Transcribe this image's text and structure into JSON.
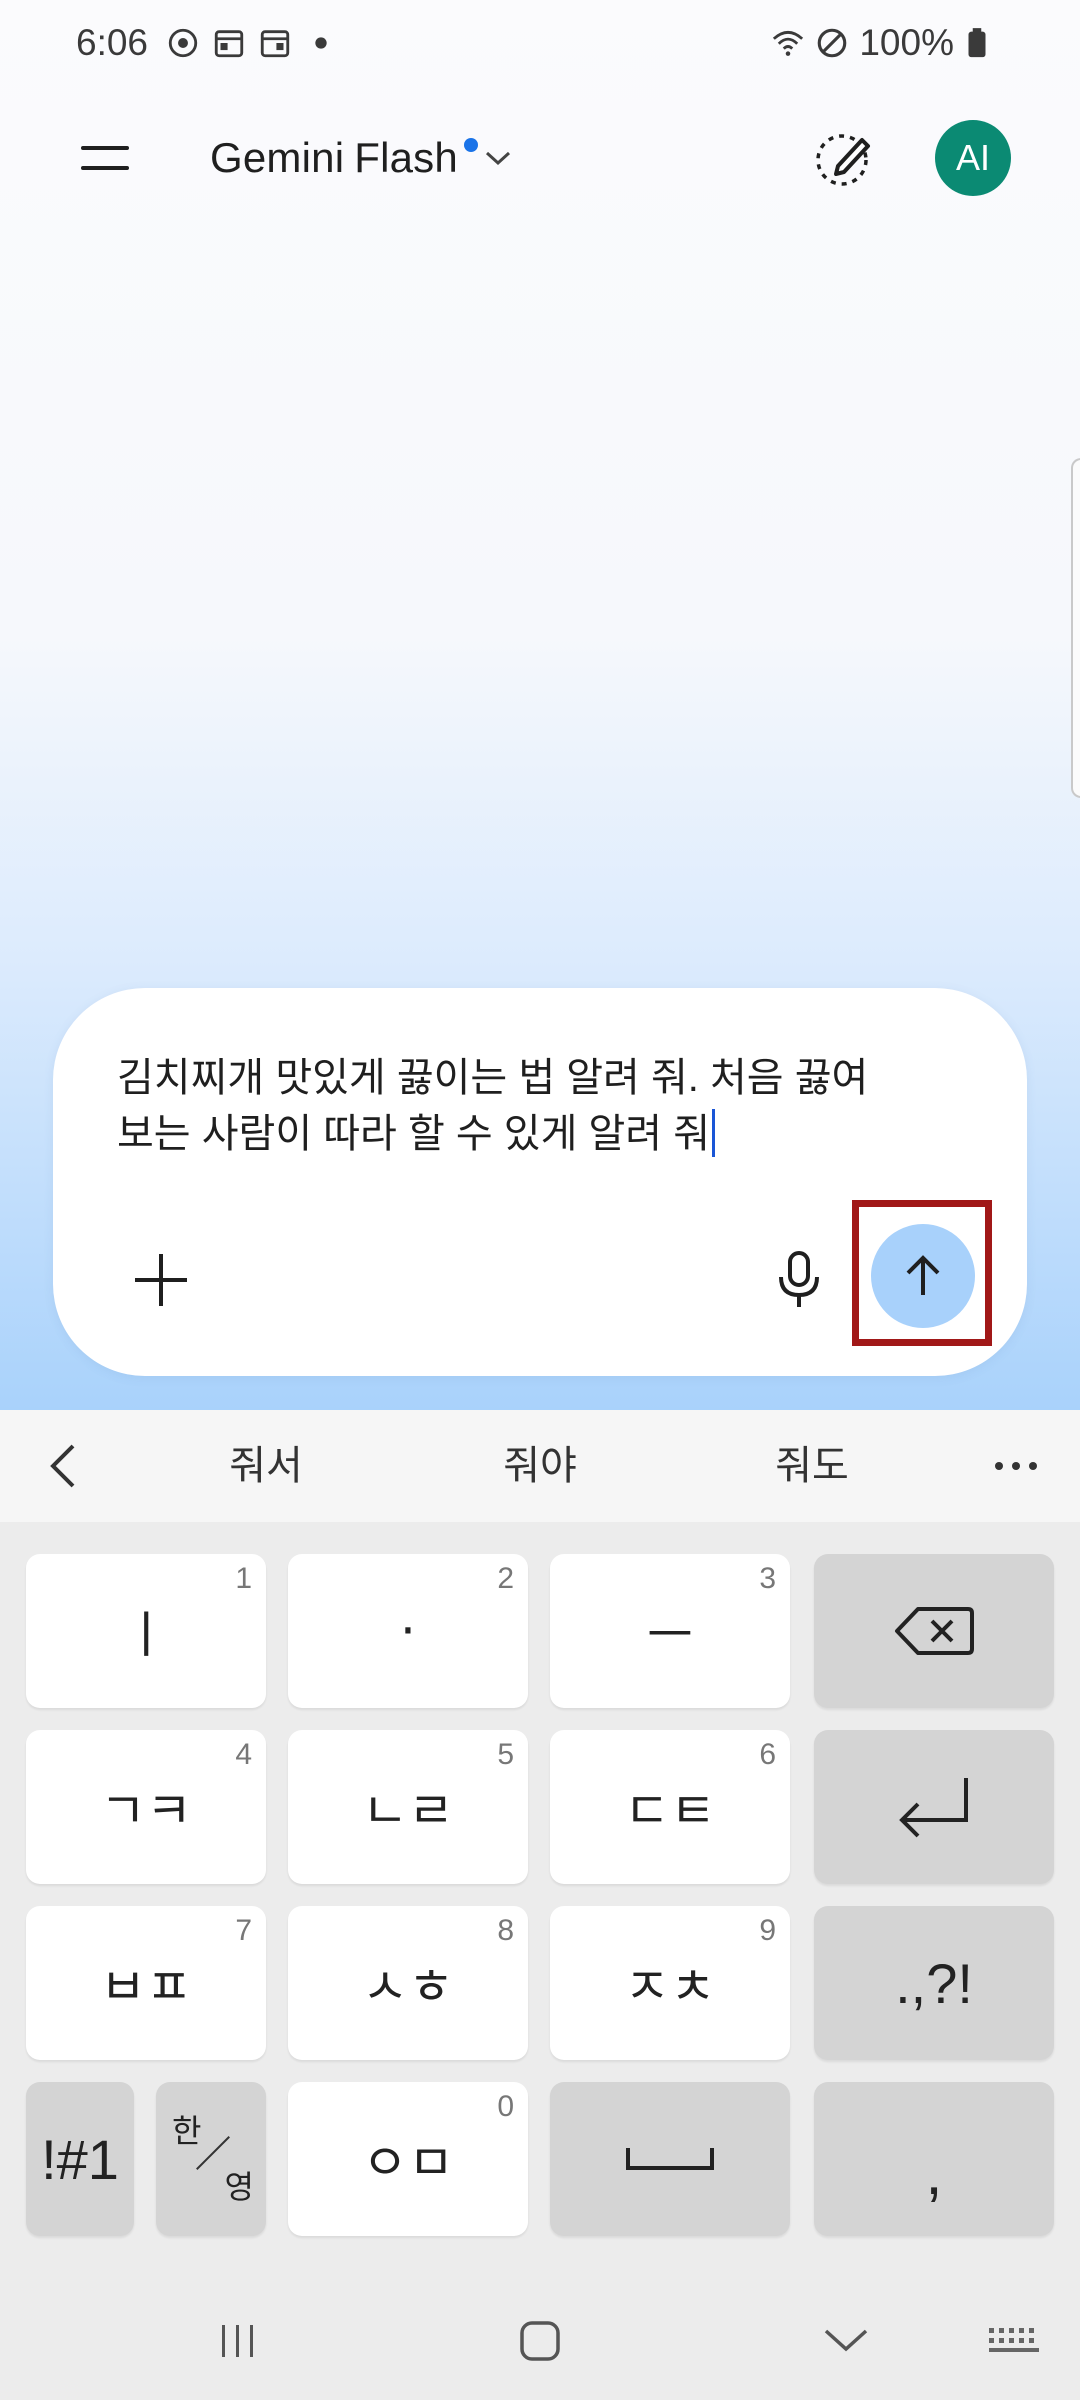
{
  "status_bar": {
    "time": "6:06",
    "battery": "100%"
  },
  "header": {
    "model_name_primary": "Gemini",
    "model_name_secondary": "Flash",
    "avatar_initials": "AI"
  },
  "input": {
    "text": "김치찌개 맛있게 끓이는 법 알려 줘. 처음 끓여\n보는 사람이 따라 할 수 있게 알려 줘"
  },
  "suggestions": [
    "줘서",
    "줘야",
    "줘도"
  ],
  "keyboard": {
    "rows": [
      [
        {
          "label": "ㅣ",
          "num": "1"
        },
        {
          "label": "·",
          "num": "2"
        },
        {
          "label": "ㅡ",
          "num": "3"
        },
        {
          "label": "",
          "icon": "backspace-icon"
        }
      ],
      [
        {
          "label": "ㄱㅋ",
          "num": "4"
        },
        {
          "label": "ㄴㄹ",
          "num": "5"
        },
        {
          "label": "ㄷㅌ",
          "num": "6"
        },
        {
          "label": "",
          "icon": "enter-icon"
        }
      ],
      [
        {
          "label": "ㅂㅍ",
          "num": "7"
        },
        {
          "label": "ㅅㅎ",
          "num": "8"
        },
        {
          "label": "ㅈㅊ",
          "num": "9"
        },
        {
          "label": ".,?!"
        }
      ]
    ],
    "bottom": {
      "symbols": "!#1",
      "lang_top": "한",
      "lang_bottom": "영",
      "om_label": "ㅇㅁ",
      "om_num": "0",
      "comma": ","
    }
  },
  "colors": {
    "accent": "#1a73e8",
    "avatar_bg": "#0b8a73",
    "send_bg": "#a8d1fb",
    "highlight": "#a11818"
  }
}
